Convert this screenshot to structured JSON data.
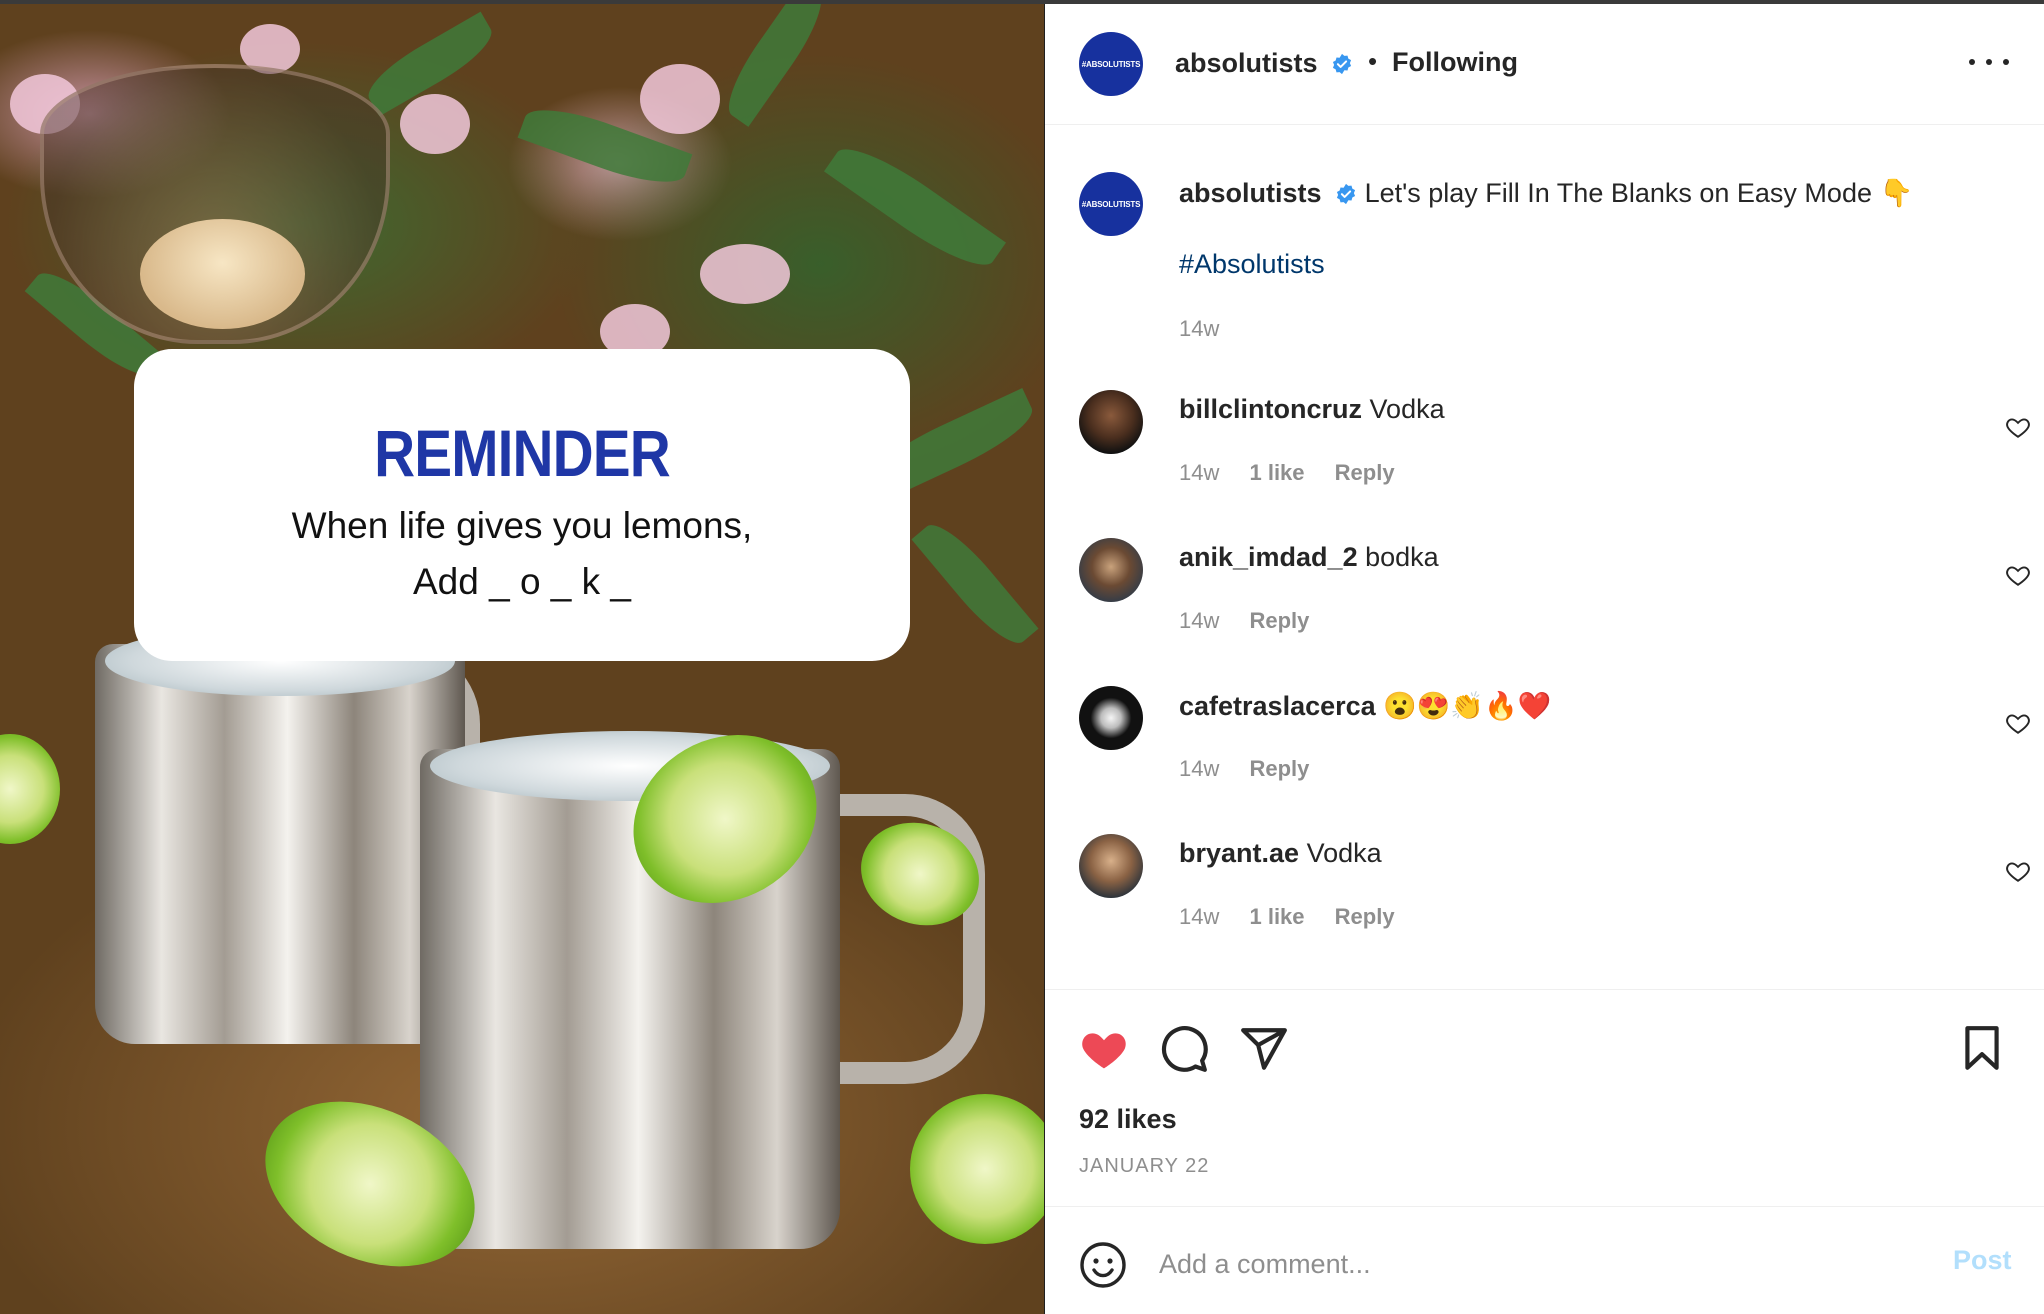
{
  "post": {
    "reminder_title": "REMINDER",
    "reminder_line1": "When life gives you lemons,",
    "reminder_line2": "Add _ o _ k _"
  },
  "header": {
    "avatar_text": "#ABSOLUTISTS",
    "username": "absolutists",
    "separator": "•",
    "follow_status": "Following"
  },
  "caption": {
    "username": "absolutists",
    "text": "Let's play Fill In The Blanks on Easy Mode 👇",
    "hashtag": "#Absolutists",
    "time": "14w"
  },
  "comments": [
    {
      "username": "billclintoncruz",
      "text": "Vodka",
      "time": "14w",
      "likes": "1 like",
      "reply": "Reply"
    },
    {
      "username": "anik_imdad_2",
      "text": "bodka",
      "time": "14w",
      "likes": "",
      "reply": "Reply"
    },
    {
      "username": "cafetraslacerca",
      "text": "😮😍👏🔥❤️",
      "time": "14w",
      "likes": "",
      "reply": "Reply"
    },
    {
      "username": "bryant.ae",
      "text": "Vodka",
      "time": "14w",
      "likes": "1 like",
      "reply": "Reply"
    }
  ],
  "actions": {
    "likes_count": "92 likes",
    "date": "JANUARY 22"
  },
  "composer": {
    "placeholder": "Add a comment...",
    "post_label": "Post"
  },
  "colors": {
    "brand_blue": "#1f37a6",
    "like_red": "#ed4956",
    "link_blue": "#00376b",
    "muted": "#8e8e8e",
    "post_disabled": "#b2dffc"
  },
  "icons": {
    "verified": "verified-badge-icon",
    "more": "more-options-icon",
    "like": "heart-filled-icon",
    "comment": "comment-bubble-icon",
    "share": "paper-plane-icon",
    "save": "bookmark-icon",
    "emoji": "smiley-icon",
    "comment_like": "heart-outline-icon"
  }
}
